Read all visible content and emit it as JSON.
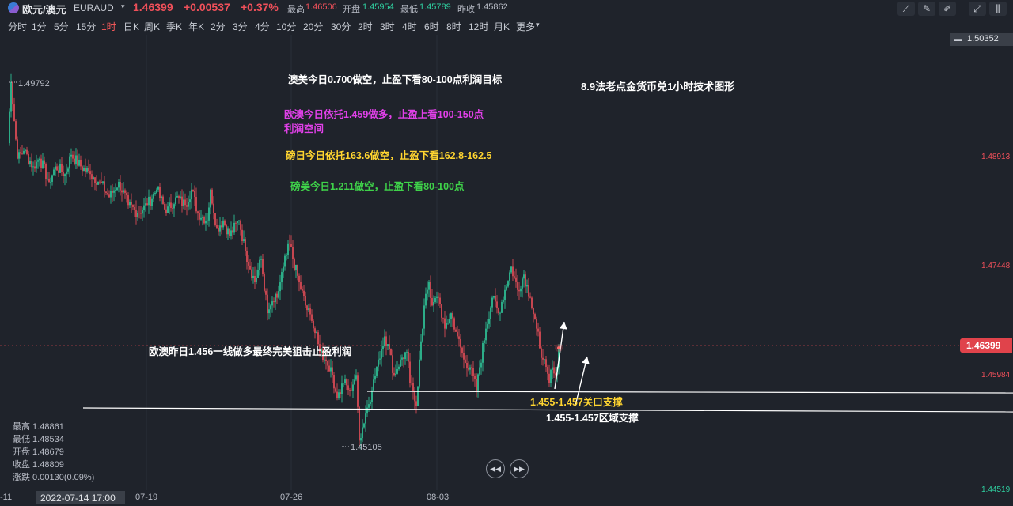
{
  "header": {
    "symbol_name": "欧元/澳元",
    "symbol_code": "EURAUD",
    "price": "1.46399",
    "change": "+0.00537",
    "change_pct": "+0.37%",
    "high_label": "最高",
    "high": "1.46506",
    "open_label": "开盘",
    "open": "1.45954",
    "low_label": "最低",
    "low": "1.45789",
    "prev_label": "昨收",
    "prev": "1.45862"
  },
  "timeframes": [
    "分时",
    "1分",
    "5分",
    "15分",
    "1时",
    "日K",
    "周K",
    "季K",
    "年K",
    "2分",
    "3分",
    "4分",
    "10分",
    "20分",
    "30分",
    "2时",
    "3时",
    "4时",
    "6时",
    "8时",
    "12时",
    "月K",
    "更多"
  ],
  "active_timeframe": "1时",
  "annotations": {
    "title": "8.9法老点金货币兑1小时技术图形",
    "audusd": "澳美今日0.700做空，止盈下看80-100点利润目标",
    "euraud_l1": "欧澳今日依托1.459做多，止盈上看100-150点",
    "euraud_l2": "利润空间",
    "gbpjpy": "磅日今日依托163.6做空，止盈下看162.8-162.5",
    "gbpusd": "磅美今日1.211做空，止盈下看80-100点",
    "yesterday": "欧澳昨日1.456一线做多最终完美狙击止盈利润",
    "support1": "1.455-1.457关口支撑",
    "support2": "1.455-1.457区域支撑"
  },
  "price_axis": {
    "top": "1.50352",
    "p1": "1.48913",
    "p2": "1.47448",
    "current": "1.46399",
    "p3": "1.45984",
    "bottom": "1.44519"
  },
  "markers": {
    "high": "1.49792",
    "low": "1.45105"
  },
  "stats": {
    "high": "最高 1.48861",
    "low": "最低 1.48534",
    "open": "开盘 1.48679",
    "close": "收盘 1.48809",
    "change": "涨跌 0.00130(0.09%)"
  },
  "time_axis": {
    "left_partial": "-11",
    "cursor": "2022-07-14 17:00",
    "d1": "07-19",
    "d2": "07-26",
    "d3": "08-03"
  },
  "colors": {
    "up": "#2fd0a0",
    "down": "#f0505a",
    "bg": "#1f232b"
  },
  "chart_data": {
    "type": "candlestick",
    "ylim": [
      1.44519,
      1.50352
    ],
    "pivots": [
      [
        0,
        1.49
      ],
      [
        2,
        1.4979
      ],
      [
        6,
        1.488
      ],
      [
        10,
        1.489
      ],
      [
        16,
        1.487
      ],
      [
        20,
        1.488
      ],
      [
        26,
        1.485
      ],
      [
        30,
        1.487
      ],
      [
        36,
        1.486
      ],
      [
        40,
        1.4885
      ],
      [
        46,
        1.487
      ],
      [
        52,
        1.486
      ],
      [
        58,
        1.485
      ],
      [
        64,
        1.483
      ],
      [
        70,
        1.485
      ],
      [
        76,
        1.482
      ],
      [
        82,
        1.481
      ],
      [
        88,
        1.482
      ],
      [
        94,
        1.484
      ],
      [
        100,
        1.481
      ],
      [
        106,
        1.483
      ],
      [
        112,
        1.482
      ],
      [
        116,
        1.484
      ],
      [
        120,
        1.481
      ],
      [
        126,
        1.48
      ],
      [
        128,
        1.484
      ],
      [
        132,
        1.479
      ],
      [
        136,
        1.48
      ],
      [
        140,
        1.478
      ],
      [
        146,
        1.48
      ],
      [
        150,
        1.476
      ],
      [
        156,
        1.472
      ],
      [
        160,
        1.475
      ],
      [
        164,
        1.468
      ],
      [
        166,
        1.469
      ],
      [
        170,
        1.47
      ],
      [
        174,
        1.474
      ],
      [
        178,
        1.477
      ],
      [
        180,
        1.475
      ],
      [
        184,
        1.472
      ],
      [
        188,
        1.469
      ],
      [
        192,
        1.467
      ],
      [
        196,
        1.464
      ],
      [
        200,
        1.462
      ],
      [
        204,
        1.461
      ],
      [
        208,
        1.457
      ],
      [
        212,
        1.459
      ],
      [
        216,
        1.458
      ],
      [
        220,
        1.46
      ],
      [
        222,
        1.4515
      ],
      [
        226,
        1.455
      ],
      [
        230,
        1.458
      ],
      [
        234,
        1.462
      ],
      [
        238,
        1.465
      ],
      [
        240,
        1.464
      ],
      [
        244,
        1.46
      ],
      [
        248,
        1.462
      ],
      [
        252,
        1.463
      ],
      [
        254,
        1.459
      ],
      [
        258,
        1.456
      ],
      [
        260,
        1.462
      ],
      [
        262,
        1.466
      ],
      [
        264,
        1.4705
      ],
      [
        266,
        1.472
      ],
      [
        268,
        1.469
      ],
      [
        272,
        1.47
      ],
      [
        276,
        1.466
      ],
      [
        280,
        1.468
      ],
      [
        284,
        1.465
      ],
      [
        288,
        1.462
      ],
      [
        292,
        1.461
      ],
      [
        296,
        1.458
      ],
      [
        298,
        1.461
      ],
      [
        302,
        1.466
      ],
      [
        306,
        1.47
      ],
      [
        310,
        1.468
      ],
      [
        314,
        1.471
      ],
      [
        318,
        1.474
      ],
      [
        322,
        1.471
      ],
      [
        326,
        1.473
      ],
      [
        330,
        1.47
      ],
      [
        334,
        1.466
      ],
      [
        338,
        1.462
      ],
      [
        342,
        1.459
      ],
      [
        344,
        1.461
      ],
      [
        346,
        1.46
      ],
      [
        348,
        1.4635
      ]
    ]
  }
}
